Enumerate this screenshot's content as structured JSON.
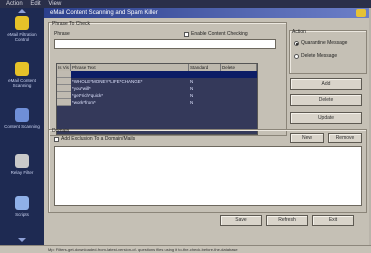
{
  "menubar": {
    "items": [
      "Action",
      "Edit",
      "View"
    ]
  },
  "sidebar": {
    "items": [
      {
        "label": "eMail Filtration Control",
        "icon": "folder-icon",
        "color": "#e6c229"
      },
      {
        "label": "eMail Content Scanning",
        "icon": "folder-icon",
        "color": "#e6c229"
      },
      {
        "label": "Content Scanning",
        "icon": "document-icon",
        "color": "#6f8fd8"
      },
      {
        "label": "Relay Filter",
        "icon": "funnel-icon",
        "color": "#c9c9c9"
      },
      {
        "label": "Scripts",
        "icon": "script-icon",
        "color": "#8fb0e8"
      }
    ]
  },
  "window": {
    "title": "eMail Content Scanning and Spam Killer"
  },
  "phrases_tab": {
    "label": "Phrase To Check"
  },
  "phrase_field": {
    "label": "Phrase",
    "value": ""
  },
  "enable_checkbox": {
    "label": "Enable Content Checking",
    "checked": false
  },
  "action_group": {
    "label": "Action",
    "options": [
      {
        "label": "Quarantine Message",
        "selected": true
      },
      {
        "label": "Delete Message",
        "selected": false
      }
    ]
  },
  "grid": {
    "columns": [
      "Is Vis",
      "Phrase Text",
      "Standard",
      "Delete"
    ],
    "rows": [
      {
        "text": "",
        "standard": "",
        "delete": ""
      },
      {
        "text": "*WHOLE*MONEY*LIFE*CHANGE*",
        "standard": "N",
        "delete": ""
      },
      {
        "text": "*you*will*",
        "standard": "N",
        "delete": ""
      },
      {
        "text": "*get*rich*quick*",
        "standard": "N",
        "delete": ""
      },
      {
        "text": "*work*from*",
        "standard": "N",
        "delete": ""
      }
    ]
  },
  "side_buttons": {
    "add": "Add",
    "delete": "Delete",
    "update": "Update"
  },
  "domains_group": {
    "label": "Domain",
    "checkbox_label": "Add Exclusion To a Domain/Mails",
    "new_button": "New",
    "remove_button": "Remove"
  },
  "footer_buttons": {
    "save": "Save",
    "refresh": "Refresh",
    "exit": "Exit"
  },
  "status_text": "Mp: Filters-get-downloaded-from-latest-version-of- questions files using it to-the-check-before-the-database"
}
